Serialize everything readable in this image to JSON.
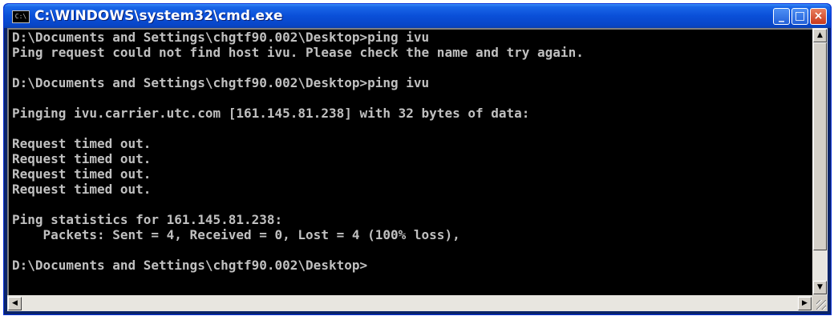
{
  "window": {
    "title": "C:\\WINDOWS\\system32\\cmd.exe",
    "icon_text": "C:\\"
  },
  "title_buttons": {
    "minimize": "_",
    "maximize": "□",
    "close": "×"
  },
  "console": {
    "text_color": "#c0c0c0",
    "background": "#000000",
    "lines": [
      "D:\\Documents and Settings\\chgtf90.002\\Desktop>ping ivu",
      "Ping request could not find host ivu. Please check the name and try again.",
      "",
      "D:\\Documents and Settings\\chgtf90.002\\Desktop>ping ivu",
      "",
      "Pinging ivu.carrier.utc.com [161.145.81.238] with 32 bytes of data:",
      "",
      "Request timed out.",
      "Request timed out.",
      "Request timed out.",
      "Request timed out.",
      "",
      "Ping statistics for 161.145.81.238:",
      "    Packets: Sent = 4, Received = 0, Lost = 4 (100% loss),",
      "",
      "D:\\Documents and Settings\\chgtf90.002\\Desktop>"
    ]
  },
  "scrollbars": {
    "up_arrow": "▲",
    "down_arrow": "▼",
    "left_arrow": "◀",
    "right_arrow": "▶"
  }
}
